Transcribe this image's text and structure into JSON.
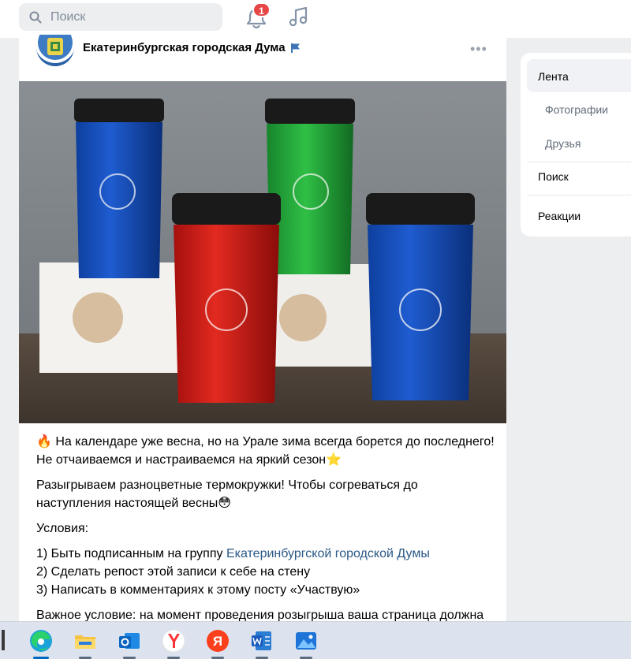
{
  "search": {
    "placeholder": "Поиск"
  },
  "notifications": {
    "count": "1"
  },
  "post": {
    "group_name": "Екатеринбургская городская Дума",
    "more_label": "•••",
    "line1": "На календаре уже весна, но на Урале зима всегда борется до последнего!",
    "line2": "Не отчаиваемся и настраиваемся на яркий сезон",
    "para2a": "Разыгрываем разноцветные термокружки! Чтобы согреваться до",
    "para2b": "наступления настоящей весны",
    "conditions_title": "Условия:",
    "cond1_prefix": "1) Быть подписанным на группу ",
    "cond1_link": "Екатеринбургской городской Думы",
    "cond2": "2) Сделать репост этой записи к себе на стену",
    "cond3": "3) Написать в комментариях к этому посту «Участвую»",
    "important": "Важное условие: на момент проведения розыгрыша ваша страница должна"
  },
  "menu": {
    "items": [
      "Лента",
      "Фотографии",
      "Друзья",
      "Поиск",
      "Реакции"
    ],
    "active": "Лента"
  },
  "taskbar": {
    "apps": [
      "edge-icon",
      "file-explorer-icon",
      "outlook-icon",
      "yandex-browser-icon",
      "yandex-icon",
      "word-icon",
      "photos-icon"
    ]
  },
  "colors": {
    "link": "#2a5885",
    "badge": "#e64646",
    "background": "#edeef0"
  }
}
